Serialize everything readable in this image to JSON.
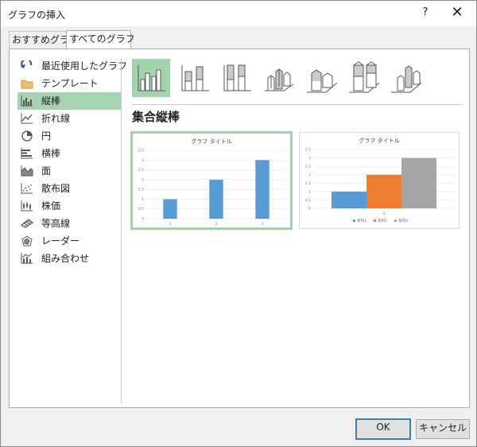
{
  "window": {
    "title": "グラフの挿入",
    "help": "?",
    "close": "✕"
  },
  "tabs": [
    {
      "label": "おすすめグラフ"
    },
    {
      "label": "すべてのグラフ"
    }
  ],
  "sidebar": {
    "items": [
      {
        "label": "最近使用したグラフ",
        "icon": "recent-icon"
      },
      {
        "label": "テンプレート",
        "icon": "folder-icon"
      },
      {
        "label": "縦棒",
        "icon": "column-chart-icon"
      },
      {
        "label": "折れ線",
        "icon": "line-chart-icon"
      },
      {
        "label": "円",
        "icon": "pie-chart-icon"
      },
      {
        "label": "横棒",
        "icon": "bar-chart-icon"
      },
      {
        "label": "面",
        "icon": "area-chart-icon"
      },
      {
        "label": "散布図",
        "icon": "scatter-chart-icon"
      },
      {
        "label": "株価",
        "icon": "stock-chart-icon"
      },
      {
        "label": "等高線",
        "icon": "surface-chart-icon"
      },
      {
        "label": "レーダー",
        "icon": "radar-chart-icon"
      },
      {
        "label": "組み合わせ",
        "icon": "combo-chart-icon"
      }
    ],
    "selected": "縦棒"
  },
  "main": {
    "heading": "集合縦棒"
  },
  "chart_data": [
    {
      "type": "bar",
      "title": "グラフ タイトル",
      "categories": [
        "1",
        "2",
        "3"
      ],
      "values": [
        1,
        2,
        3
      ],
      "ylim": [
        0,
        3.5
      ],
      "yticks": [
        "0",
        "0.5",
        "1",
        "1.5",
        "2",
        "2.5",
        "3",
        "3.5"
      ],
      "color": "#5b9bd5",
      "grid": true
    },
    {
      "type": "bar",
      "title": "グラフ タイトル",
      "categories": [
        "1"
      ],
      "series": [
        {
          "name": "系列1",
          "values": [
            1
          ],
          "color": "#5b9bd5"
        },
        {
          "name": "系列2",
          "values": [
            2
          ],
          "color": "#ed7d31"
        },
        {
          "name": "系列3",
          "values": [
            3
          ],
          "color": "#a5a5a5"
        }
      ],
      "ylim": [
        0,
        3.5
      ],
      "yticks": [
        "0",
        "0.5",
        "1",
        "1.5",
        "2",
        "2.5",
        "3",
        "3.5"
      ],
      "legend": "bottom",
      "grid": true
    }
  ],
  "buttons": {
    "ok": "OK",
    "cancel": "キャンセル"
  },
  "colors": {
    "selection": "#a3d3ad",
    "accent": "#3c7fb1"
  }
}
